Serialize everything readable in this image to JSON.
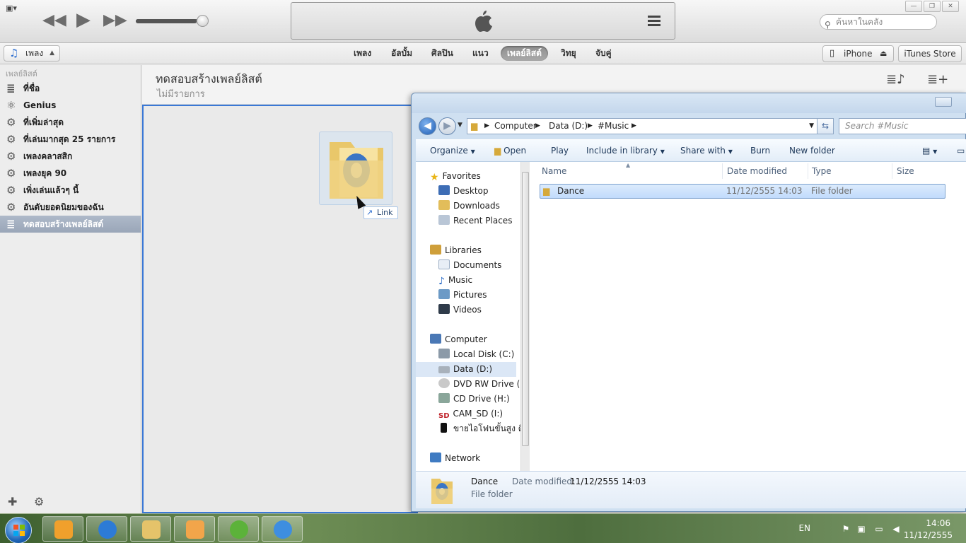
{
  "itunes": {
    "search_placeholder": "ค้นหาในคลัง",
    "library_select": "เพลง",
    "nav_tabs": [
      {
        "label": "เพลง"
      },
      {
        "label": "อัลบั้ม"
      },
      {
        "label": "ศิลปิน"
      },
      {
        "label": "แนว"
      },
      {
        "label": "เพลย์ลิสต์",
        "active": true
      },
      {
        "label": "วิทยุ"
      },
      {
        "label": "จับคู่"
      }
    ],
    "device_button": "iPhone",
    "store_button": "iTunes Store",
    "volume_level": 0.9,
    "sidebar": {
      "heading": "เพลย์ลิสต์",
      "items": [
        {
          "label": "ที่ชื่อ",
          "icon": "playlist-icon"
        },
        {
          "label": "Genius",
          "icon": "genius-icon"
        },
        {
          "label": "ที่เพิ่มล่าสุด",
          "icon": "gear-icon"
        },
        {
          "label": "ที่เล่นมากสุด 25 รายการ",
          "icon": "gear-icon"
        },
        {
          "label": "เพลงคลาสสิก",
          "icon": "gear-icon"
        },
        {
          "label": "เพลงยุค 90",
          "icon": "gear-icon"
        },
        {
          "label": "เพิ่งเล่นแล้วๆ นี้",
          "icon": "gear-icon"
        },
        {
          "label": "อันดับยอดนิยมของฉัน",
          "icon": "gear-icon"
        },
        {
          "label": "ทดสอบสร้างเพลย์ลิสต์",
          "icon": "playlist-icon",
          "selected": true
        }
      ]
    },
    "main": {
      "playlist_title": "ทดสอบสร้างเพลย์ลิสต์",
      "playlist_subtitle": "ไม่มีรายการ"
    },
    "drag_hint": "Link",
    "accent_color": "#3a78d6"
  },
  "explorer": {
    "address": [
      "Computer",
      "Data (D:)",
      "#Music"
    ],
    "search_placeholder": "Search #Music",
    "toolbar": [
      "Organize",
      "Open",
      "Play",
      "Include in library",
      "Share with",
      "Burn",
      "New folder"
    ],
    "nav": {
      "favorites": {
        "label": "Favorites",
        "items": [
          "Desktop",
          "Downloads",
          "Recent Places"
        ]
      },
      "libraries": {
        "label": "Libraries",
        "items": [
          "Documents",
          "Music",
          "Pictures",
          "Videos"
        ]
      },
      "computer": {
        "label": "Computer",
        "items": [
          "Local Disk (C:)",
          "Data (D:)",
          "DVD RW Drive (E:",
          "CD Drive (H:)",
          "CAM_SD (I:)",
          "ขายไอโฟนขั้นสูง ดิ"
        ]
      },
      "network": {
        "label": "Network"
      }
    },
    "columns": [
      "Name",
      "Date modified",
      "Type",
      "Size"
    ],
    "files": [
      {
        "name": "Dance",
        "date_modified": "11/12/2555 14:03",
        "type": "File folder",
        "size": ""
      }
    ],
    "details": {
      "name": "Dance",
      "date_label": "Date modified:",
      "date_value": "11/12/2555 14:03",
      "type": "File folder"
    }
  },
  "taskbar": {
    "language": "EN",
    "time": "14:06",
    "date": "11/12/2555"
  }
}
